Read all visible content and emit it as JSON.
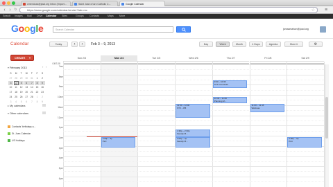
{
  "browser": {
    "tabs": [
      {
        "label": "cmendoza@jusd.org Inbox (Import..."
      },
      {
        "label": "Saint Joan of Arc Catholic C..."
      },
      {
        "label": "Google Calendar"
      }
    ],
    "url": "https://www.google.com/calendar/render?tab=mc"
  },
  "google_bar": {
    "items": [
      "Search",
      "Images",
      "Mail",
      "Drive",
      "Calendar",
      "Sites",
      "Groups",
      "Contacts",
      "Maps",
      "More"
    ],
    "active": "Calendar"
  },
  "header": {
    "logo": "Google",
    "search_placeholder": "Search Calendar",
    "account": "jsmacmahon@jusd.org"
  },
  "calendar_toolbar": {
    "title": "Calendar",
    "today_label": "Today",
    "prev": "‹",
    "next": "›",
    "date_range": "Feb 3 – 9, 2013",
    "views": [
      "Day",
      "Week",
      "Month",
      "4 Days",
      "Agenda"
    ],
    "active_view": "Week",
    "more_label": "More ▾",
    "settings_icon": "⚙"
  },
  "sidebar": {
    "create_label": "CREATE",
    "mini_title": "February 2013",
    "weekdays": [
      "S",
      "M",
      "T",
      "W",
      "T",
      "F",
      "S"
    ],
    "weeks": [
      [
        "27",
        "28",
        "29",
        "30",
        "31",
        "1",
        "2"
      ],
      [
        "3",
        "4",
        "5",
        "6",
        "7",
        "8",
        "9"
      ],
      [
        "10",
        "11",
        "12",
        "13",
        "14",
        "15",
        "16"
      ],
      [
        "17",
        "18",
        "19",
        "20",
        "21",
        "22",
        "23"
      ],
      [
        "24",
        "25",
        "26",
        "27",
        "28",
        "1",
        "2"
      ],
      [
        "3",
        "4",
        "5",
        "6",
        "7",
        "8",
        "9"
      ]
    ],
    "my_calendars_label": "My calendars",
    "other_calendars_label": "Other calendars",
    "other_calendars": [
      {
        "name": "Contacts' birthdays a...",
        "color": "#f2a640"
      },
      {
        "name": "St. Joan Calendar",
        "color": "#7bd148"
      },
      {
        "name": "US Holidays",
        "color": "#51b749"
      }
    ]
  },
  "grid": {
    "tz_label": "GMT-08",
    "days": [
      "Sun 2/3",
      "Mon 2/4",
      "Tue 2/5",
      "Wed 2/6",
      "Thu 2/7",
      "Fri 2/8",
      "Sat 2/9"
    ],
    "today_index": 1,
    "hours": [
      "7am",
      "8am",
      "9am",
      "10am",
      "11am",
      "12pm",
      "1pm",
      "2pm",
      "3pm",
      "4pm",
      "5pm",
      "6pm"
    ],
    "events": [
      {
        "title": "9:30 – 10:30",
        "subtitle": "STX Counselor",
        "day": 4
      },
      {
        "title": "10:30 – 11:00",
        "subtitle": "Planning M...",
        "day": 4
      },
      {
        "title": "11:00 – 12:00",
        "subtitle": "STX – PB",
        "day": 3
      },
      {
        "title": "11:00 – 11:45",
        "subtitle": "Wellness",
        "day": 5
      },
      {
        "title": "1:30p – 2:30p",
        "subtitle": "Faculty M...",
        "day": 3
      },
      {
        "title": "2:00p – 3p",
        "subtitle": "PLC",
        "day": 1
      },
      {
        "title": "2:00p – 3p",
        "subtitle": "Faculty M...",
        "day": 3
      },
      {
        "title": "2:00p – 3p",
        "subtitle": "PLC",
        "day": 6
      }
    ]
  }
}
